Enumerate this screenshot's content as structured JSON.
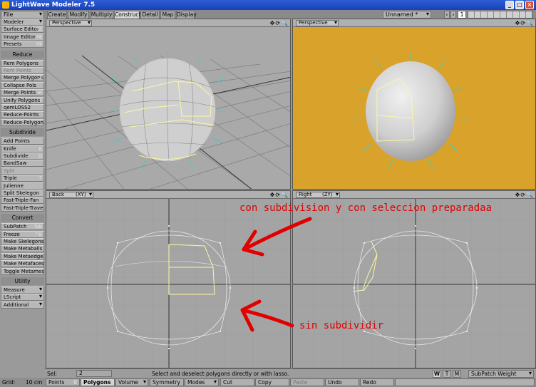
{
  "window": {
    "title": "LightWave Modeler 7.5"
  },
  "top": {
    "file_menu": "File",
    "tabs": [
      "Create",
      "Modify",
      "Multiply",
      "Construct",
      "Detail",
      "Map",
      "Display"
    ],
    "active_tab": "Construct",
    "object_name": "Unnamed *",
    "layer_number": "1"
  },
  "sidebar": {
    "modeler_menu": "Modeler",
    "surface_editor": {
      "label": "Surface Editor",
      "shortcut": "F5"
    },
    "image_editor": {
      "label": "Image Editor",
      "shortcut": "F6"
    },
    "presets": {
      "label": "Presets",
      "shortcut": "F8"
    },
    "reduce_header": "Reduce",
    "rem_polygons": "Rem Polygons",
    "rem_points": "Rem Points",
    "merge_polygons": {
      "label": "Merge Polygons",
      "shortcut": "Z"
    },
    "collapse_pols": "Collapse Pols",
    "merge_points": {
      "label": "Merge Points",
      "shortcut": "m"
    },
    "unify_polygons": {
      "label": "Unify Polygons",
      "shortcut": "F"
    },
    "qemloss2": "qemLOSS2",
    "reduce_points": "Reduce-Points",
    "reduce_polygons": "Reduce-Polygons",
    "subdivide_header": "Subdivide",
    "add_points": "Add Points",
    "knife": {
      "label": "Knife",
      "shortcut": "K"
    },
    "subdivide": {
      "label": "Subdivide",
      "shortcut": "D"
    },
    "bandsaw": "BandSaw",
    "split": "Split",
    "triple": {
      "label": "Triple",
      "shortcut": "T"
    },
    "julienne": "Julienne",
    "split_skelegon": "Split Skelegon",
    "fast_triple_fan": "Fast-Triple-Fan",
    "fast_triple_traverse": "Fast-Triple-Trave...",
    "convert_header": "Convert",
    "subpatch": {
      "label": "SubPatch",
      "shortcut": "Tab"
    },
    "freeze": {
      "label": "Freeze",
      "shortcut": "^D"
    },
    "make_skelegons": "Make Skelegons",
    "make_metaballs": "Make Metaballs",
    "make_metaedges": "Make Metaedges",
    "make_metafaces": "Make Metafaces",
    "toggle_metamesh": "Toggle Metamesh",
    "utility_header": "Utility",
    "measure": "Measure",
    "lscript": "LScript",
    "additional": "Additional",
    "grid_label": "Grid:",
    "grid_value": "10 cm"
  },
  "viewports": {
    "top_left": {
      "view": "Perspective"
    },
    "top_right": {
      "view": "Perspective"
    },
    "bottom_left": {
      "view": "Back",
      "axes": "(XY)"
    },
    "bottom_right": {
      "view": "Right",
      "axes": "(ZY)"
    }
  },
  "annotations": {
    "text_1": "con subdivision y con seleccion preparadaa",
    "text_2": "sin subdividir"
  },
  "status": {
    "sel_label": "Sel:",
    "sel_count": "2",
    "message": "Select and deselect polygons directly or with lasso.",
    "wtm": [
      "W",
      "T",
      "M"
    ],
    "weight_menu": "SubPatch Weight"
  },
  "modebar": {
    "points": "Points",
    "points_count": "0",
    "polygons": "Polygons",
    "volume": "Volume",
    "symmetry": "Symmetry",
    "modes": "Modes",
    "cut": "Cut",
    "copy": "Copy",
    "paste": "Paste",
    "undo": "Undo",
    "redo": "Redo"
  },
  "colors": {
    "background_yellow": "#d9a22a",
    "annotation_red": "#e00000",
    "selection_yellow": "#fcf8a0",
    "normal_cyan": "#2fd2c8"
  }
}
